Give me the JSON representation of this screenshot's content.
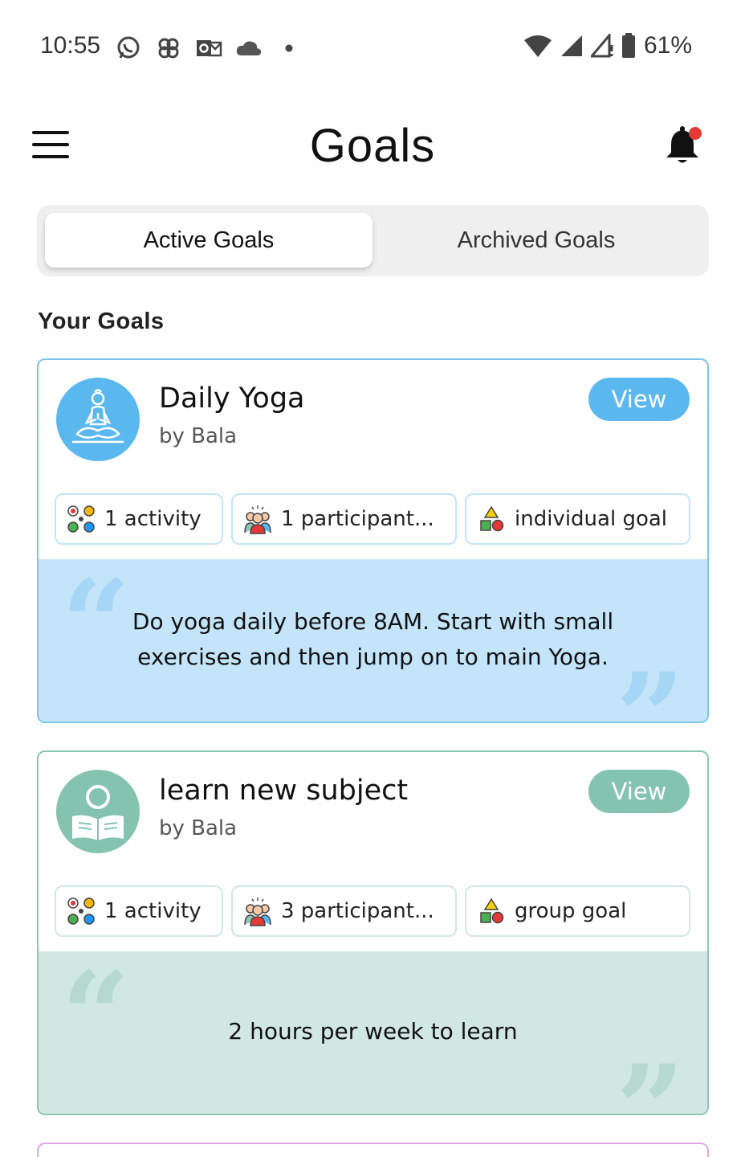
{
  "status_bar": {
    "time": "10:55",
    "left_icons": [
      "whatsapp-icon",
      "pinwheel-icon",
      "outlook-icon",
      "cloud-icon",
      "dot-icon"
    ],
    "battery": "61%"
  },
  "header": {
    "title": "Goals"
  },
  "tabs": [
    {
      "label": "Active Goals",
      "active": true
    },
    {
      "label": "Archived Goals",
      "active": false
    }
  ],
  "section_title": "Your Goals",
  "goals": [
    {
      "title": "Daily Yoga",
      "author": "by Bala",
      "view_label": "View",
      "accent": "#5bb8ef",
      "chips": {
        "activity": "1 activity",
        "participants": "1 participant...",
        "type": "individual goal"
      },
      "description": "Do yoga daily before 8AM. Start with small exercises and then jump on to main Yoga.",
      "icon": "yoga-icon"
    },
    {
      "title": "learn new subject",
      "author": "by Bala",
      "view_label": "View",
      "accent": "#84c3b0",
      "chips": {
        "activity": "1 activity",
        "participants": "3 participant...",
        "type": "group goal"
      },
      "description": "2 hours per week to learn",
      "icon": "reading-icon"
    }
  ],
  "colors": {
    "yoga_border": "#7cc6ee",
    "yoga_desc_bg": "#c4e4fa",
    "study_border": "#8dc6b4",
    "study_desc_bg": "#d1e7e2",
    "next_card_border": "#e6a6e6",
    "notification_dot": "#e53935"
  }
}
